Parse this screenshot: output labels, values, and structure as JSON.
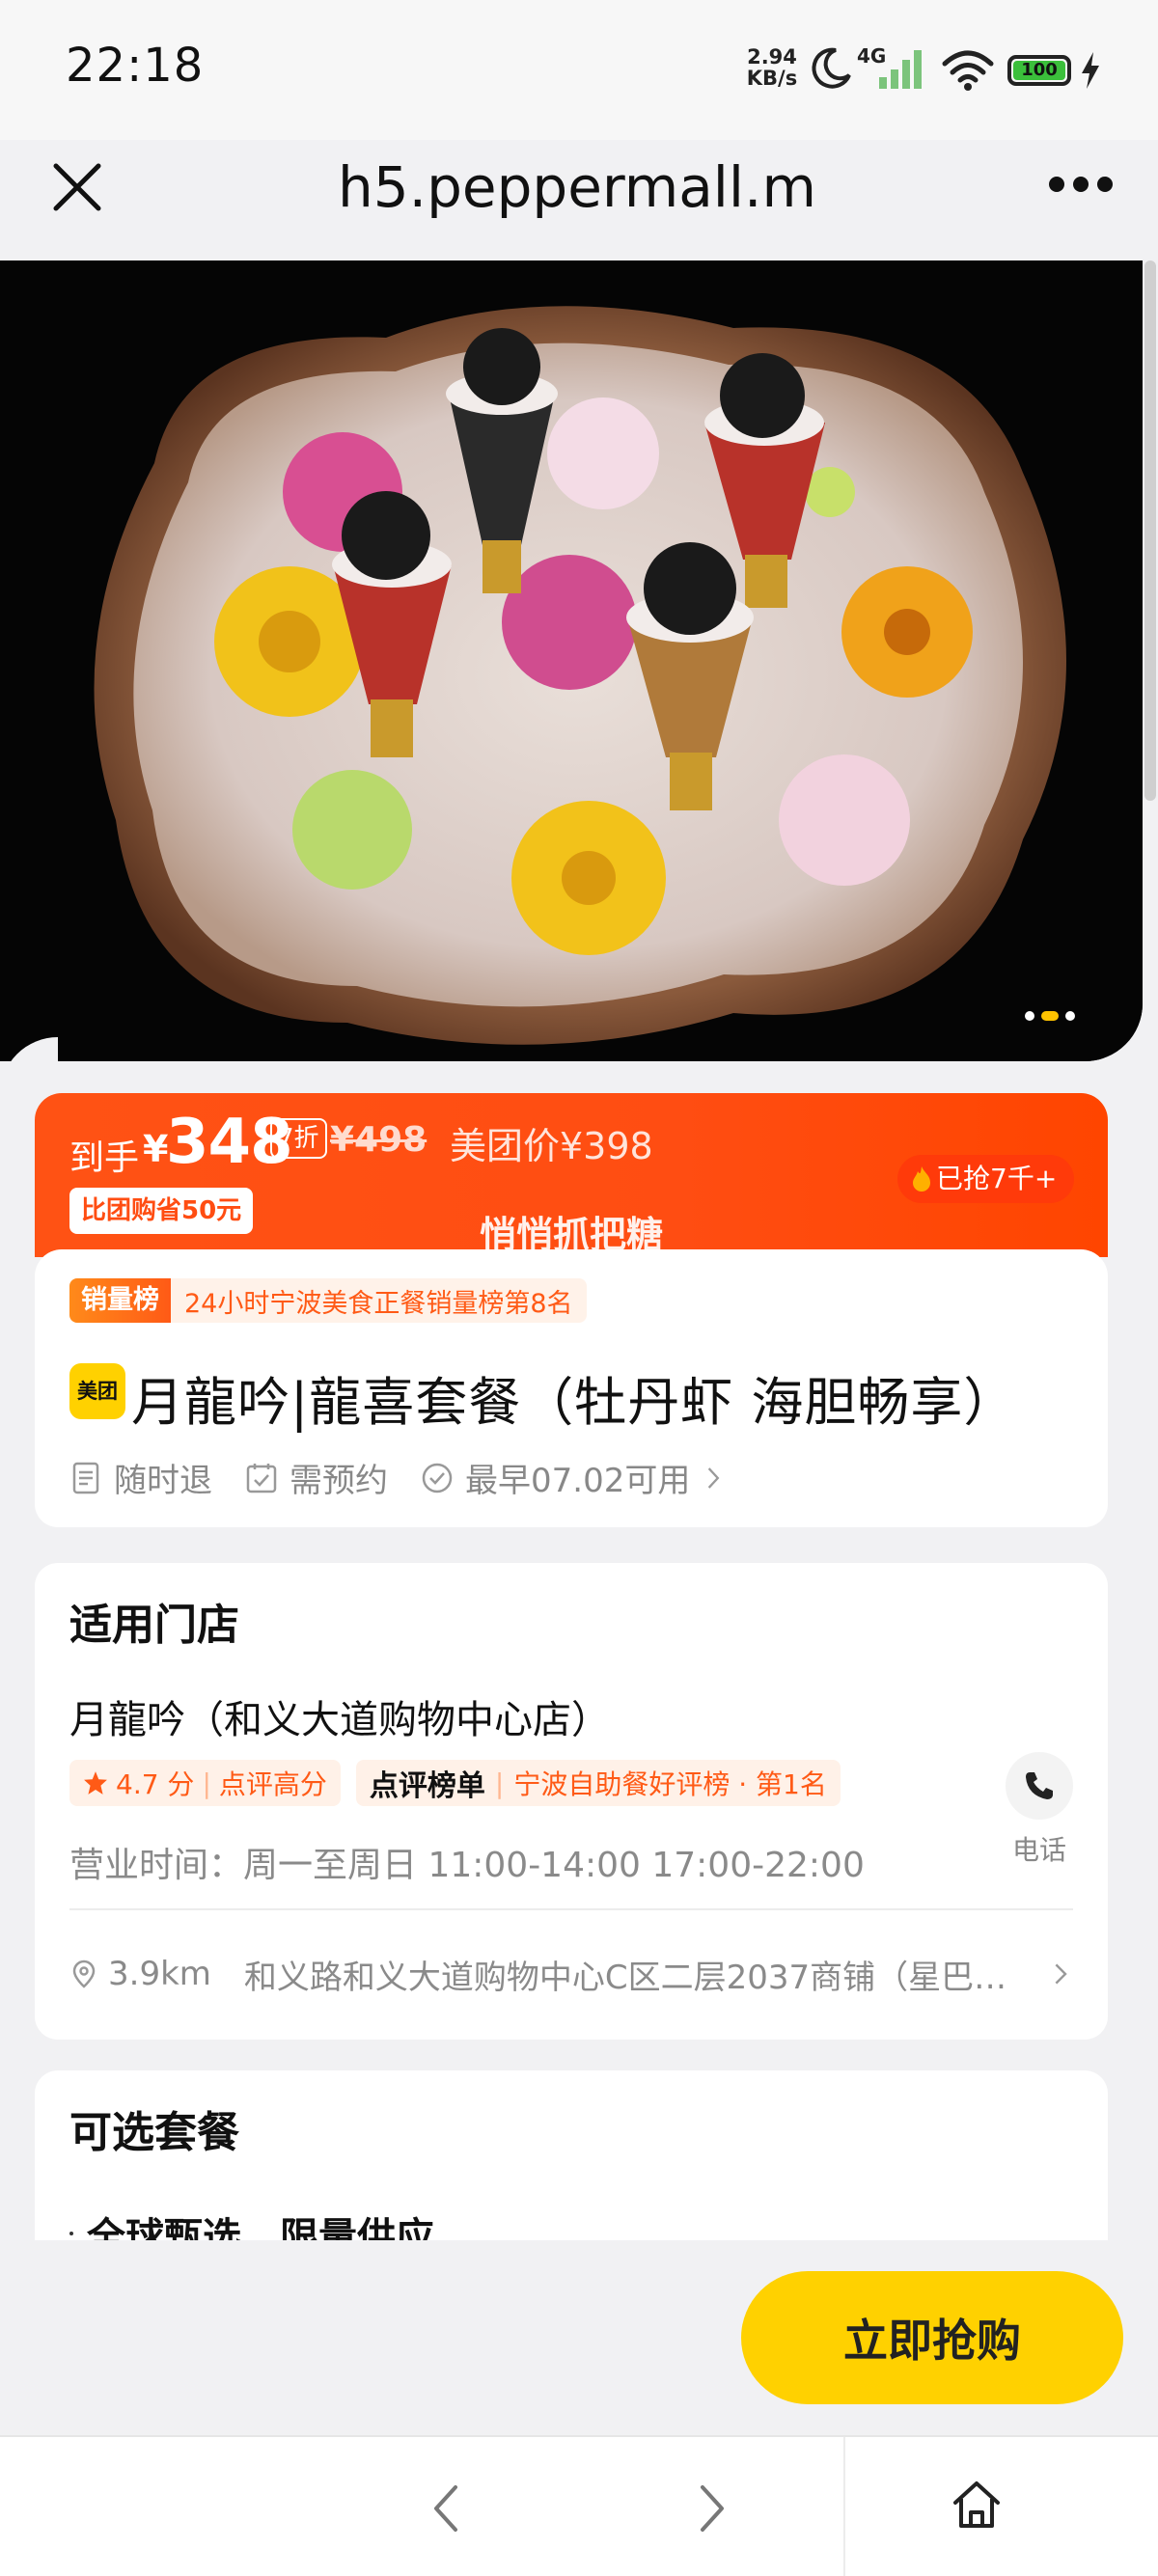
{
  "status_bar": {
    "time": "22:18",
    "speed_value": "2.94",
    "speed_unit": "KB/s",
    "network": "4G",
    "battery": "100",
    "icons": [
      "moon-icon",
      "signal-icon",
      "wifi-icon",
      "battery-icon",
      "charging-icon"
    ]
  },
  "nav": {
    "url": "h5.peppermall.m...",
    "icons": [
      "close-icon",
      "more-icon"
    ]
  },
  "carousel": {
    "total": 3,
    "active": 2
  },
  "price": {
    "prefix": "到手",
    "currency": "¥",
    "value": "348",
    "discount": "7折",
    "original": "¥498",
    "meituan_price": "美团价¥398",
    "save_tag": "比团购省50元",
    "grabbed": "已抢7千+",
    "slogan": "悄悄抓把糖"
  },
  "product": {
    "rank_label": "销量榜",
    "rank_text": "24小时宁波美食正餐销量榜第8名",
    "logo_text": "美团",
    "title": "月龍吟|龍喜套餐（牡丹虾 海胆畅享）",
    "features": [
      "随时退",
      "需预约",
      "最早07.02可用"
    ]
  },
  "store": {
    "section_title": "适用门店",
    "name": "月龍吟（和义大道购物中心店）",
    "rating": "4.7 分",
    "rating_note": "点评高分",
    "rank_brand": "点评榜单",
    "rank_text": "宁波自助餐好评榜 · 第1名",
    "hours": "营业时间：周一至周日 11:00-14:00 17:00-22:00",
    "phone_label": "电话",
    "distance": "3.9km",
    "address": "和义路和义大道购物中心C区二层2037商铺（星巴…"
  },
  "package": {
    "section_title": "可选套餐",
    "item": "全球甄选、限量供应"
  },
  "buy_button": "立即抢购",
  "colors": {
    "accent_orange": "#ff4d12",
    "button_yellow": "#ffd100"
  }
}
